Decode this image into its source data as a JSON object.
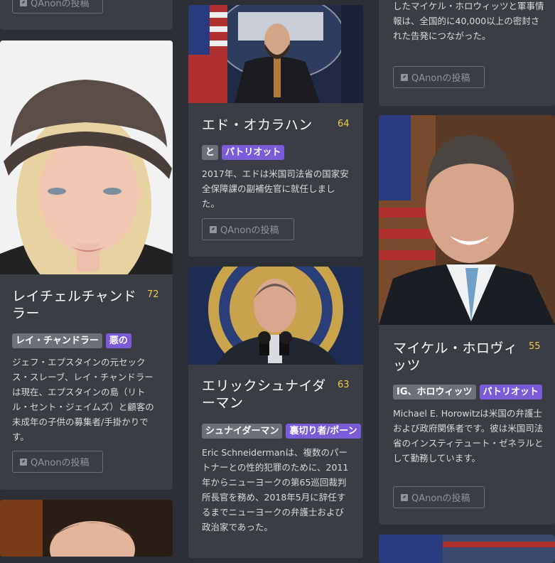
{
  "button_label": "QAnonの投稿",
  "cards": [
    {
      "name": "レイチェルチャンド\nラー",
      "score": "72",
      "tags": [
        "レイ・チャンドラー",
        "悪の"
      ],
      "desc": "ジェフ・エプスタインの元セックス・スレーブ、レイ・チャンドラーは現在、エプスタインの島（リトル・セント・ジェイムズ）と顧客の未成年の子供の募集者/手掛かりです。"
    },
    {
      "name": "エド・オカラハン",
      "score": "64",
      "tags": [
        "と",
        "パトリオット"
      ],
      "desc": "2017年、エドは米国司法省の国家安全保障課の副補佐官に就任しました。"
    },
    {
      "name": "エリックシュナイダ\nーマン",
      "score": "63",
      "tags": [
        "シュナイダーマン",
        "裏切り者/ポーン"
      ],
      "desc": "Eric Schneidermanは、複数のパートナーとの性的犯罪のために、2011年からニューヨークの第65巡回裁判所長官を務め、2018年5月に辞任するまでニューヨークの弁護士および政治家であった。"
    },
    {
      "name": "",
      "score": "",
      "tags": [],
      "desc": "したマイケル・ホロウィッツと軍事情報は、全国的に40,000以上の密封された告発につながった。"
    },
    {
      "name": "マイケル・ホロヴィ\nッツ",
      "score": "55",
      "tags": [
        "IG、ホロウィッツ",
        "パトリオット"
      ],
      "desc": "Michael E. Horowitzは米国の弁護士および政府関係者です。彼は米国司法省のインスティテュート・ゼネラルとして勤務しています。"
    }
  ]
}
